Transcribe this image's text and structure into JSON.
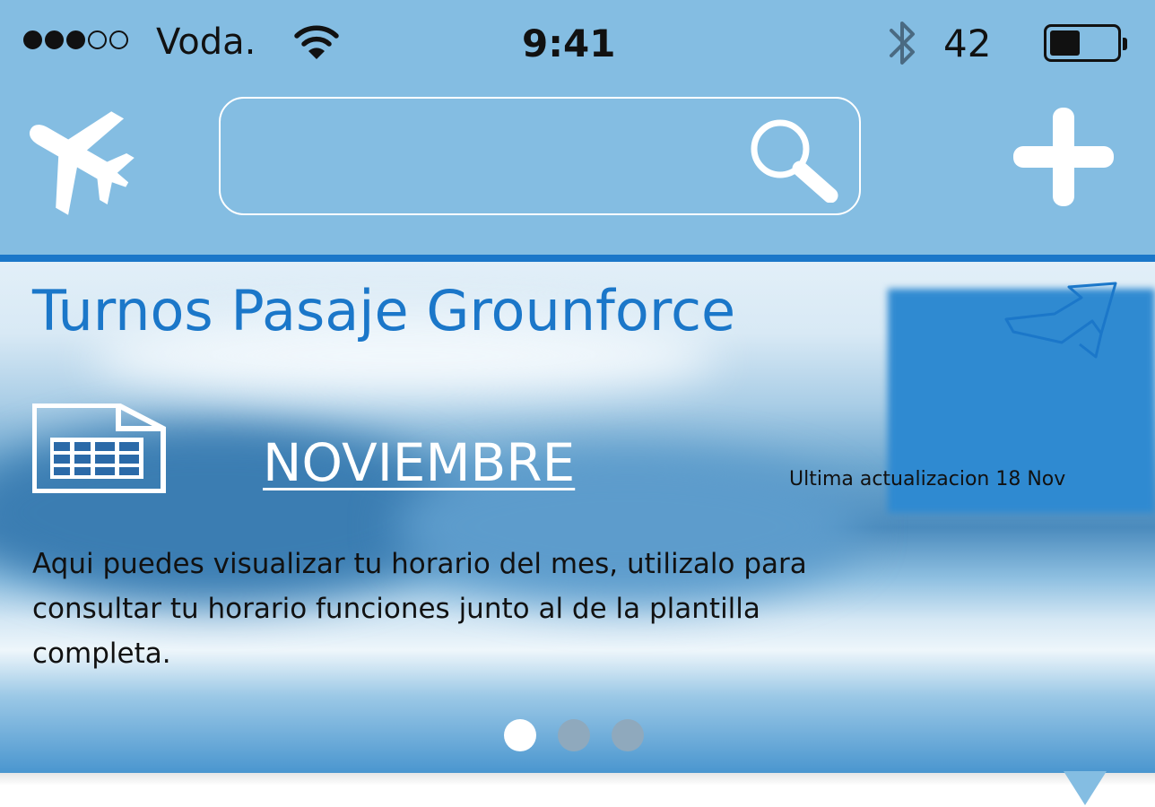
{
  "status_bar": {
    "signal_strength": 3,
    "signal_max": 5,
    "carrier": "Voda.",
    "time": "9:41",
    "battery_text": "42",
    "battery_level": 0.42
  },
  "nav": {
    "search": {
      "value": "",
      "placeholder": ""
    }
  },
  "card": {
    "title": "Turnos Pasaje Grounforce",
    "month_link": "NOVIEMBRE",
    "last_updated": "Ultima actualizacion 18 Nov",
    "description": "Aqui puedes visualizar tu horario del mes, utilizalo para consultar tu horario funciones junto al de la plantilla completa."
  },
  "pager": {
    "total": 3,
    "active_index": 0
  },
  "colors": {
    "nav_background": "#84bde2",
    "accent_blue": "#1b77c9",
    "text_dark": "#111111"
  }
}
